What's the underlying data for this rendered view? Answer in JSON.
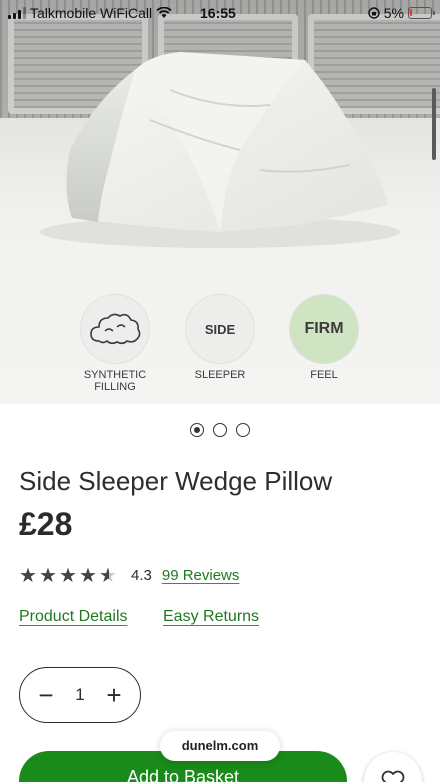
{
  "status_bar": {
    "carrier": "Talkmobile WiFiCall",
    "time": "16:55",
    "battery": "5%",
    "battery_level": 0.05,
    "battery_color": "#e33333"
  },
  "product": {
    "title": "Side Sleeper Wedge Pillow",
    "price": "£28",
    "rating_stars": 4.5,
    "rating": "4.3",
    "reviews": "99 Reviews"
  },
  "features": [
    {
      "icon": "cloud-icon",
      "label": "SYNTHETIC FILLING"
    },
    {
      "badge": "SIDE",
      "label": "SLEEPER"
    },
    {
      "badge": "FIRM",
      "label": "FEEL"
    }
  ],
  "gallery": {
    "current_page": 1,
    "total_pages": 3
  },
  "links": {
    "product_details": "Product Details",
    "easy_returns": "Easy Returns"
  },
  "quantity": {
    "minus": "−",
    "value": "1",
    "plus": "+"
  },
  "actions": {
    "add_to_basket": "Add to Basket"
  },
  "browser": {
    "url": "dunelm.com"
  },
  "colors": {
    "accent_green": "#1a8a1a",
    "link_green": "#1f7a1f",
    "firm_badge": "#cfe4c2"
  }
}
